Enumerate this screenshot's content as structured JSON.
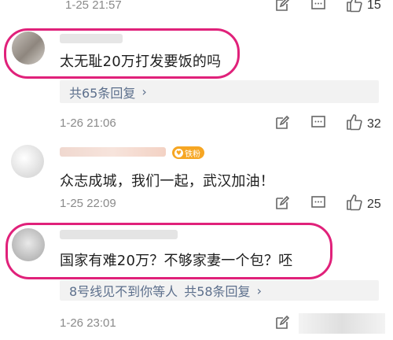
{
  "comments": [
    {
      "time": "1-25 21:57",
      "likes": "15"
    },
    {
      "text": "太无耻20万打发要饭的吗",
      "reply_label": "共65条回复",
      "time": "1-26 21:06",
      "likes": "32"
    },
    {
      "badge": "铁粉",
      "text": "众志成城，我们一起，武汉加油！",
      "time": "1-25 22:09",
      "likes": "25"
    },
    {
      "text": "国家有难20万？不够家妻一个包？呸",
      "reply_user": "8号线见不到你等人",
      "reply_label": "共58条回复",
      "time": "1-26 23:01"
    }
  ],
  "reply_chevron": "›",
  "icons": [
    "edit-icon",
    "comment-icon",
    "like-icon"
  ],
  "colors": {
    "highlight": "#e0217a",
    "reply_link": "#5c6f8c",
    "badge": "#f6a623"
  }
}
